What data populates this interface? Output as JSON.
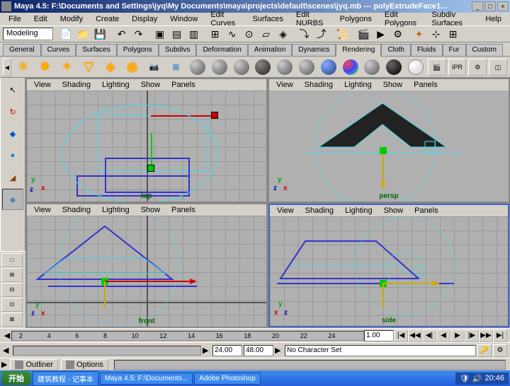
{
  "titlebar": {
    "text": "Maya 4.5: F:\\Documents and Settings\\jyq\\My Documents\\maya\\projects\\default\\scenes\\jyq.mb  ---  polyExtrudeFace1...",
    "min": "_",
    "max": "□",
    "close": "×"
  },
  "menubar": [
    "File",
    "Edit",
    "Modify",
    "Create",
    "Display",
    "Window",
    "Edit Curves",
    "Surfaces",
    "Edit NURBS",
    "Polygons",
    "Edit Polygons",
    "Subdiv Surfaces",
    "Help"
  ],
  "mode": "Modeling",
  "shelf_tabs": [
    "General",
    "Curves",
    "Surfaces",
    "Polygons",
    "Subdivs",
    "Deformation",
    "Animation",
    "Dynamics",
    "Rendering",
    "Cloth",
    "Fluids",
    "Fur",
    "Custom"
  ],
  "shelf_active": "Rendering",
  "vp_menu": [
    "View",
    "Shading",
    "Lighting",
    "Show",
    "Panels"
  ],
  "viewports": {
    "top_left": {
      "label": "top"
    },
    "top_right": {
      "label": "persp"
    },
    "bottom_left": {
      "label": "front"
    },
    "bottom_right": {
      "label": "side"
    }
  },
  "timeline_ticks": [
    "2",
    "4",
    "6",
    "8",
    "10",
    "12",
    "14",
    "16",
    "18",
    "20",
    "22",
    "24"
  ],
  "playback": {
    "current": "1.00",
    "start": "24.00",
    "end": "48.00",
    "char": "No Character Set"
  },
  "panels": {
    "outliner": "Outliner",
    "options": "Options",
    "menu_toggle": "▶"
  },
  "taskbar": {
    "start": "开始",
    "tasks": [
      "建筑教程 - 记事本",
      "Maya 4.5: F:\\Documents...",
      "Adobe Photoshop"
    ],
    "clock": "20:46"
  }
}
